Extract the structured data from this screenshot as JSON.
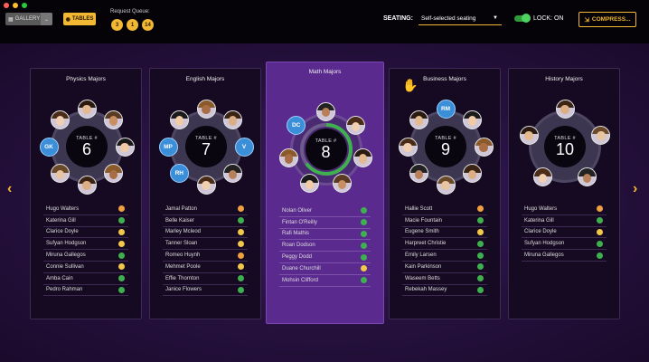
{
  "colors": {
    "red": "#ff5f57",
    "yellow": "#febc2e",
    "green": "#28c840",
    "accent": "#f2b733",
    "status_green": "#3fb04f",
    "status_orange": "#f0a040",
    "status_yellow": "#f2c84b",
    "seat_blue": "#3b8ed8",
    "active_progress": "#3fb04f"
  },
  "toolbar": {
    "gallery_label": "GALLERY",
    "gallery_icon": "grid-icon",
    "tables_label": "TABLES",
    "tables_icon": "table-icon",
    "queue_label": "Request Queue:",
    "queue": [
      "3",
      "1",
      "14"
    ],
    "seating_label": "SEATING:",
    "seating_value": "Self-selected seating",
    "lock_label": "LOCK: ON",
    "compress_label": "COMPRESS..."
  },
  "nav": {
    "prev_icon": "chevron-left-icon",
    "next_icon": "chevron-right-icon"
  },
  "tables": [
    {
      "title": "Physics Majors",
      "table_label": "TABLE #",
      "number": "6",
      "raised_hand": false,
      "progress": null,
      "seats": [
        {
          "type": "photo"
        },
        {
          "type": "photo"
        },
        {
          "type": "photo"
        },
        {
          "type": "photo"
        },
        {
          "type": "photo"
        },
        {
          "type": "photo"
        },
        {
          "type": "initials",
          "initials": "GK"
        },
        {
          "type": "photo"
        }
      ],
      "students": [
        {
          "name": "Hugo Walters",
          "status": "orange"
        },
        {
          "name": "Katerina Gill",
          "status": "green"
        },
        {
          "name": "Clarice Doyle",
          "status": "yellow"
        },
        {
          "name": "Sufyan Hodgson",
          "status": "yellow"
        },
        {
          "name": "Miruna Gallegos",
          "status": "green"
        },
        {
          "name": "Connie Sullivan",
          "status": "yellow"
        },
        {
          "name": "Amba Cain",
          "status": "green"
        },
        {
          "name": "Pedro Rahman",
          "status": "green"
        }
      ]
    },
    {
      "title": "English Majors",
      "table_label": "TABLE #",
      "number": "7",
      "raised_hand": false,
      "progress": null,
      "seats": [
        {
          "type": "photo"
        },
        {
          "type": "photo"
        },
        {
          "type": "initials",
          "initials": "V"
        },
        {
          "type": "photo"
        },
        {
          "type": "photo"
        },
        {
          "type": "initials",
          "initials": "RH"
        },
        {
          "type": "initials",
          "initials": "MP"
        },
        {
          "type": "photo"
        }
      ],
      "students": [
        {
          "name": "Jamal Patton",
          "status": "orange"
        },
        {
          "name": "Belle Kaiser",
          "status": "green"
        },
        {
          "name": "Marley Mcleod",
          "status": "yellow"
        },
        {
          "name": "Tanner Sloan",
          "status": "yellow"
        },
        {
          "name": "Romeo Huynh",
          "status": "orange"
        },
        {
          "name": "Mehmet Poole",
          "status": "yellow"
        },
        {
          "name": "Effie Thornton",
          "status": "green"
        },
        {
          "name": "Janice Flowers",
          "status": "green"
        }
      ]
    },
    {
      "title": "Math Majors",
      "table_label": "TABLE #",
      "number": "8",
      "raised_hand": false,
      "progress": 0.65,
      "seats": [
        {
          "type": "photo"
        },
        {
          "type": "photo"
        },
        {
          "type": "photo"
        },
        {
          "type": "photo"
        },
        {
          "type": "photo"
        },
        {
          "type": "photo"
        },
        {
          "type": "initials",
          "initials": "DC"
        }
      ],
      "students": [
        {
          "name": "Nolan Oliver",
          "status": "green"
        },
        {
          "name": "Fintan O'Reilly",
          "status": "green"
        },
        {
          "name": "Rafi Mathis",
          "status": "green"
        },
        {
          "name": "Roan Dodson",
          "status": "green"
        },
        {
          "name": "Peggy Dodd",
          "status": "green"
        },
        {
          "name": "Duane Churchill",
          "status": "yellow"
        },
        {
          "name": "Mohsin Clifford",
          "status": "green"
        }
      ]
    },
    {
      "title": "Business Majors",
      "table_label": "TABLE #",
      "number": "9",
      "raised_hand": true,
      "hand_icon": "raised-hand-icon",
      "progress": null,
      "seats": [
        {
          "type": "initials",
          "initials": "RM"
        },
        {
          "type": "photo"
        },
        {
          "type": "photo"
        },
        {
          "type": "photo"
        },
        {
          "type": "photo"
        },
        {
          "type": "photo"
        },
        {
          "type": "photo"
        },
        {
          "type": "photo"
        }
      ],
      "students": [
        {
          "name": "Hallie Scott",
          "status": "orange"
        },
        {
          "name": "Macie Fountain",
          "status": "green"
        },
        {
          "name": "Eugene Smith",
          "status": "yellow"
        },
        {
          "name": "Harpreet Christie",
          "status": "green"
        },
        {
          "name": "Emily Larsen",
          "status": "green"
        },
        {
          "name": "Kain Parkinson",
          "status": "green"
        },
        {
          "name": "Waseem Betts",
          "status": "green"
        },
        {
          "name": "Rebekah Massey",
          "status": "green"
        }
      ]
    },
    {
      "title": "History Majors",
      "table_label": "TABLE #",
      "number": "10",
      "raised_hand": false,
      "progress": null,
      "seats": [
        {
          "type": "photo"
        },
        {
          "type": "photo"
        },
        {
          "type": "photo"
        },
        {
          "type": "photo"
        },
        {
          "type": "photo"
        }
      ],
      "students": [
        {
          "name": "Hugo Walters",
          "status": "orange"
        },
        {
          "name": "Katerina Gill",
          "status": "green"
        },
        {
          "name": "Clarice Doyle",
          "status": "yellow"
        },
        {
          "name": "Sufyan Hodgson",
          "status": "green"
        },
        {
          "name": "Miruna Gallegos",
          "status": "green"
        }
      ]
    }
  ]
}
